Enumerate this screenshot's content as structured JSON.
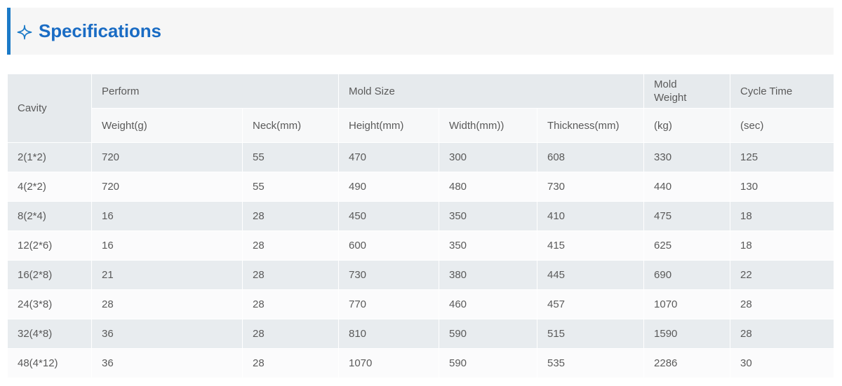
{
  "section": {
    "title": "Specifications",
    "icon": "sparkle-icon",
    "accent_color": "#1b7ac7",
    "title_color": "#1a6cc4",
    "band_background": "#f6f6f6"
  },
  "table": {
    "group_headers": {
      "cavity": "Cavity",
      "perform": "Perform",
      "mold_size": "Mold Size",
      "mold_weight": "Mold\nWeight",
      "cycle_time": "Cycle Time"
    },
    "sub_headers": {
      "weight": "Weight(g)",
      "neck": "Neck(mm)",
      "height": "Height(mm)",
      "width": "Width(mm))",
      "thickness": "Thickness(mm)",
      "mold_weight_unit": "(kg)",
      "cycle_time_unit": "(sec)"
    },
    "rows": [
      {
        "cavity": "2(1*2)",
        "weight": "720",
        "neck": "55",
        "height": "470",
        "width": "300",
        "thickness": "608",
        "mold_weight": "330",
        "cycle_time": "125"
      },
      {
        "cavity": "4(2*2)",
        "weight": "720",
        "neck": "55",
        "height": "490",
        "width": "480",
        "thickness": "730",
        "mold_weight": "440",
        "cycle_time": "130"
      },
      {
        "cavity": "8(2*4)",
        "weight": "16",
        "neck": "28",
        "height": "450",
        "width": "350",
        "thickness": "410",
        "mold_weight": "475",
        "cycle_time": "18"
      },
      {
        "cavity": "12(2*6)",
        "weight": "16",
        "neck": "28",
        "height": "600",
        "width": "350",
        "thickness": "415",
        "mold_weight": "625",
        "cycle_time": "18"
      },
      {
        "cavity": "16(2*8)",
        "weight": "21",
        "neck": "28",
        "height": "730",
        "width": "380",
        "thickness": "445",
        "mold_weight": "690",
        "cycle_time": "22"
      },
      {
        "cavity": "24(3*8)",
        "weight": "28",
        "neck": "28",
        "height": "770",
        "width": "460",
        "thickness": "457",
        "mold_weight": "1070",
        "cycle_time": "28"
      },
      {
        "cavity": "32(4*8)",
        "weight": "36",
        "neck": "28",
        "height": "810",
        "width": "590",
        "thickness": "515",
        "mold_weight": "1590",
        "cycle_time": "28"
      },
      {
        "cavity": "48(4*12)",
        "weight": "36",
        "neck": "28",
        "height": "1070",
        "width": "590",
        "thickness": "535",
        "mold_weight": "2286",
        "cycle_time": "30"
      }
    ]
  }
}
